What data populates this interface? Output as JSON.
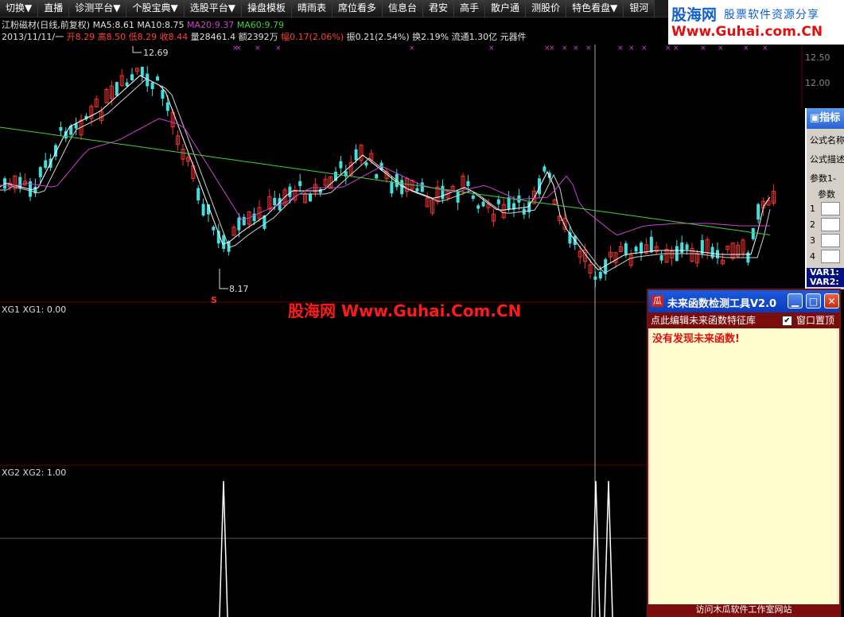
{
  "toolbar": {
    "items": [
      "切换▼",
      "直播",
      "诊测平台▼",
      "个股宝典▼",
      "选股平台▼",
      "操盘模板",
      "晴雨表",
      "席位看多",
      "信息台",
      "君安",
      "高手",
      "散户通",
      "测股价",
      "特色看盘▼",
      "银河"
    ]
  },
  "logo": {
    "brand": "股海网",
    "slogan": "股票软件资源分享",
    "url": "Www.Guhai.com.CN"
  },
  "stock_info": {
    "name": "江粉磁材(日线,前复权)",
    "ma5_label": "MA5:",
    "ma5": "8.61",
    "ma10_label": "MA10:",
    "ma10": "8.75",
    "ma20_label": "MA20:",
    "ma20": "9.37",
    "ma60_label": "MA60:",
    "ma60": "9.79",
    "date": "2013/11/11/一",
    "open": "开8.29",
    "high": "高8.50",
    "low": "低8.29",
    "close": "收8.44",
    "volume": "量28461.4",
    "amount": "额2392万",
    "change": "幅0.17(2.06%)",
    "amplitude": "振0.21(2.54%)",
    "turnover": "换2.19%",
    "float": "流通1.30亿",
    "sector": "元器件"
  },
  "price_axis": [
    "12.50",
    "12.00"
  ],
  "annotations": {
    "high": "12.69",
    "low": "8.17",
    "signal": "S"
  },
  "watermark": "股海网 Www.Guhai.Com.CN",
  "pane1": {
    "label": "XG1  XG1: 0.00"
  },
  "pane2": {
    "label": "XG2  XG2: 1.00"
  },
  "indicator_window": {
    "title": "指标",
    "formula_name": "公式名称",
    "formula_desc": "公式描述",
    "params": "参数1-",
    "params2": "参数",
    "rows": [
      "1",
      "2",
      "3",
      "4"
    ],
    "var1": "VAR1:",
    "var2": "VAR2:"
  },
  "tool_window": {
    "icon": "瓜",
    "title": "未来函数检测工具V2.0",
    "edit_link": "点此编辑未来函数特征库",
    "topmost_label": "窗口置顶",
    "topmost_checked": "✔",
    "result": "没有发现未来函数!",
    "footer": "访问木瓜软件工作室网站"
  },
  "colors": {
    "up": "#ff3030",
    "down": "#40e0e0",
    "ma5": "#ffffff",
    "ma10": "#d0d0d0",
    "ma20": "#d040d0",
    "ma60": "#40d040"
  },
  "chart_data": {
    "type": "candlestick",
    "ma_labels": [
      "MA5",
      "MA10",
      "MA20",
      "MA60"
    ],
    "annotations": [
      {
        "label": "12.69"
      },
      {
        "label": "8.17"
      }
    ],
    "xg2_signal": [
      0,
      0,
      0,
      1,
      0,
      0,
      0,
      0,
      0,
      0,
      0,
      1,
      1
    ]
  }
}
